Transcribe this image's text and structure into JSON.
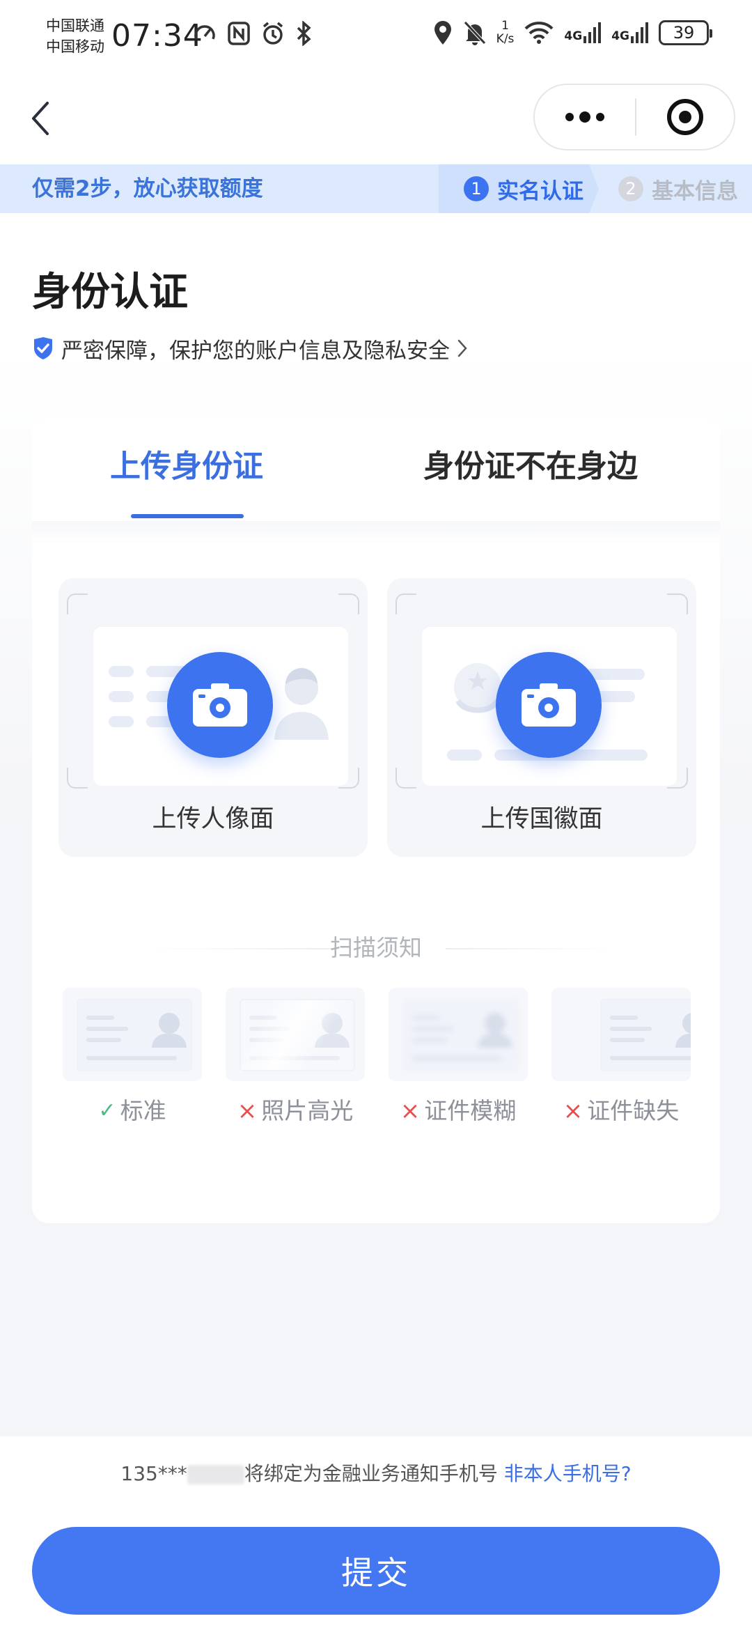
{
  "status_bar": {
    "carrier_1": "中国联通",
    "carrier_2": "中国移动",
    "time": "07:34",
    "net_speed_value": "1",
    "net_speed_unit": "K/s",
    "network_1": "4G",
    "network_2": "4G",
    "battery": "39"
  },
  "nav": {
    "more_icon": "more-dots-icon",
    "close_icon": "target-close-icon"
  },
  "steps": {
    "tip": "仅需2步，放心获取额度",
    "items": [
      {
        "num": "1",
        "label": "实名认证",
        "active": true
      },
      {
        "num": "2",
        "label": "基本信息",
        "active": false
      }
    ]
  },
  "header": {
    "title": "身份认证",
    "privacy_text": "严密保障，保护您的账户信息及隐私安全"
  },
  "tabs": [
    {
      "label": "上传身份证",
      "active": true
    },
    {
      "label": "身份证不在身边",
      "active": false
    }
  ],
  "upload_tiles": [
    {
      "label": "上传人像面"
    },
    {
      "label": "上传国徽面"
    }
  ],
  "scan_notice": {
    "title": "扫描须知",
    "samples": [
      {
        "label": "标准",
        "ok": true
      },
      {
        "label": "照片高光",
        "ok": false
      },
      {
        "label": "证件模糊",
        "ok": false
      },
      {
        "label": "证件缺失",
        "ok": false
      }
    ]
  },
  "bottom": {
    "phone_prefix": "135***",
    "phone_note": "将绑定为金融业务通知手机号",
    "phone_link": "非本人手机号?",
    "submit_label": "提交"
  },
  "colors": {
    "accent": "#4478f3",
    "tab_active": "#3b6fe0",
    "ok": "#4fb987",
    "bad": "#e94f4f"
  }
}
